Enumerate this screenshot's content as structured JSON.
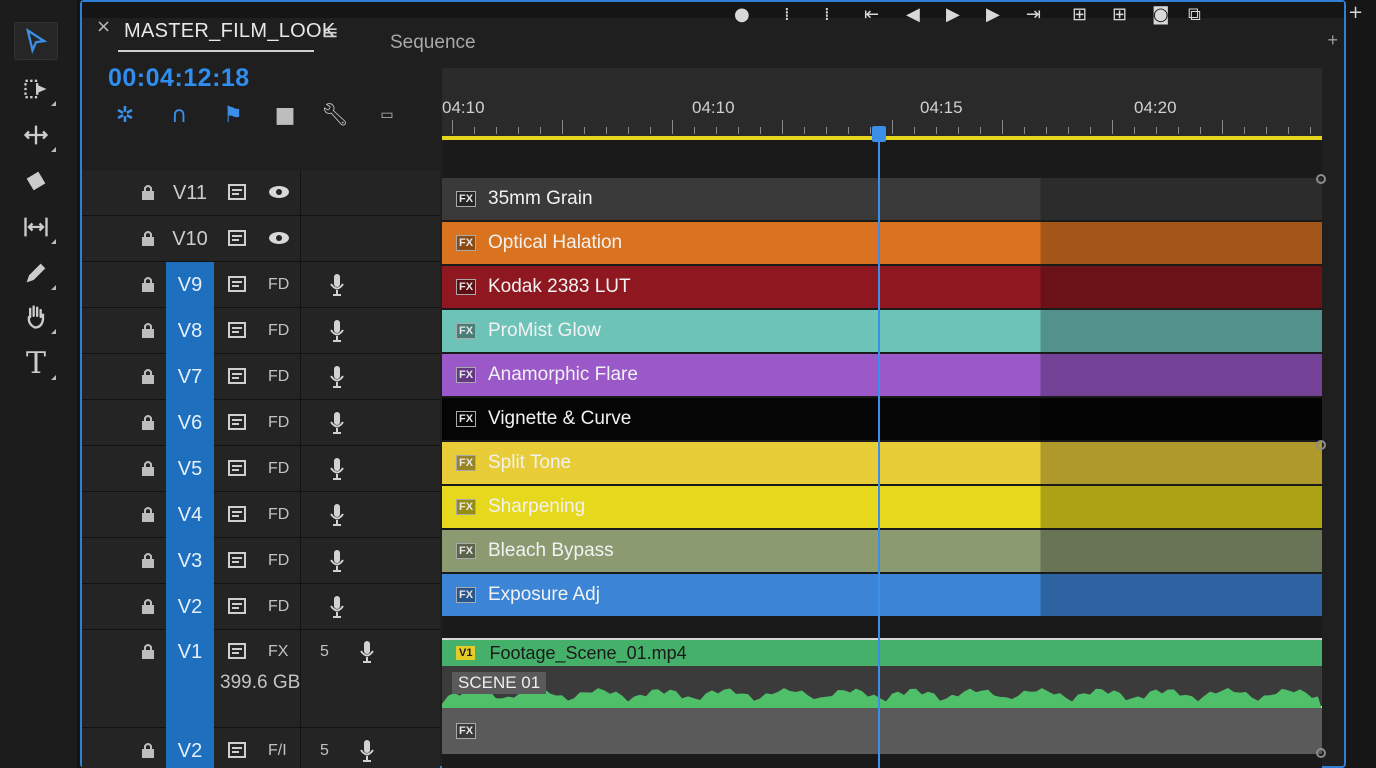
{
  "tools": [
    {
      "name": "selection-tool",
      "icon": "arrow-icon",
      "active": true
    },
    {
      "name": "track-select-tool",
      "icon": "track-select-icon"
    },
    {
      "name": "ripple-edit-tool",
      "icon": "ripple-edit-icon"
    },
    {
      "name": "razor-tool",
      "icon": "razor-icon"
    },
    {
      "name": "slip-tool",
      "icon": "slip-icon"
    },
    {
      "name": "pen-tool",
      "icon": "pen-icon"
    },
    {
      "name": "hand-tool",
      "icon": "hand-icon"
    },
    {
      "name": "type-tool",
      "icon": "type-icon",
      "label": "T"
    }
  ],
  "panel": {
    "tab_close": "×",
    "tab_title": "MASTER_FILM_LOOK",
    "tab_menu": "≡",
    "sequence_label": "Sequence",
    "plus": "+"
  },
  "timecode": "00:04:12:18",
  "ruler": {
    "labels": [
      "04:10",
      "04:10",
      "04:15",
      "04:20"
    ]
  },
  "tracks": [
    {
      "name": "V11",
      "toggle": "eye",
      "target": false
    },
    {
      "name": "V10",
      "toggle": "eye",
      "target": false
    },
    {
      "name": "V9",
      "aux": "FD",
      "target": true
    },
    {
      "name": "V8",
      "aux": "FD",
      "target": true
    },
    {
      "name": "V7",
      "aux": "FD",
      "target": true
    },
    {
      "name": "V6",
      "aux": "FD",
      "target": true
    },
    {
      "name": "V5",
      "aux": "FD",
      "target": true
    },
    {
      "name": "V4",
      "aux": "FD",
      "target": true
    },
    {
      "name": "V3",
      "aux": "FD",
      "target": true
    },
    {
      "name": "V2",
      "aux": "FD",
      "target": true
    },
    {
      "name": "V1",
      "aux": "FX",
      "num": "5",
      "extra": "399.6 GB",
      "target": true
    },
    {
      "name": "V2",
      "aux": "F/I",
      "num": "5",
      "target": true
    }
  ],
  "clips": [
    {
      "label": "FX",
      "name": "35mm Grain",
      "color": "#3a3a3a"
    },
    {
      "label": "FX",
      "name": "Optical Halation",
      "color": "#d9731f"
    },
    {
      "label": "FX",
      "name": "Kodak 2383 LUT",
      "color": "#8f1820"
    },
    {
      "label": "FX",
      "name": "ProMist Glow",
      "color": "#6ec3b8"
    },
    {
      "label": "FX",
      "name": "Anamorphic Flare",
      "color": "#9a58c9"
    },
    {
      "label": "FX",
      "name": "Vignette & Curve",
      "color": "#050505"
    },
    {
      "label": "FX",
      "name": "Split Tone",
      "color": "#e8cc38"
    },
    {
      "label": "FX",
      "name": "Sharpening",
      "color": "#e6d81c"
    },
    {
      "label": "FX",
      "name": "Bleach Bypass",
      "color": "#8c9a72"
    },
    {
      "label": "FX",
      "name": "Exposure Adj",
      "color": "#3b84d6"
    }
  ],
  "footage": {
    "badge": "V1",
    "name": "Footage_Scene_01.mp4",
    "color": "#45b06a",
    "marker": "SCENE 01"
  },
  "bottom_clip_label": "FX"
}
